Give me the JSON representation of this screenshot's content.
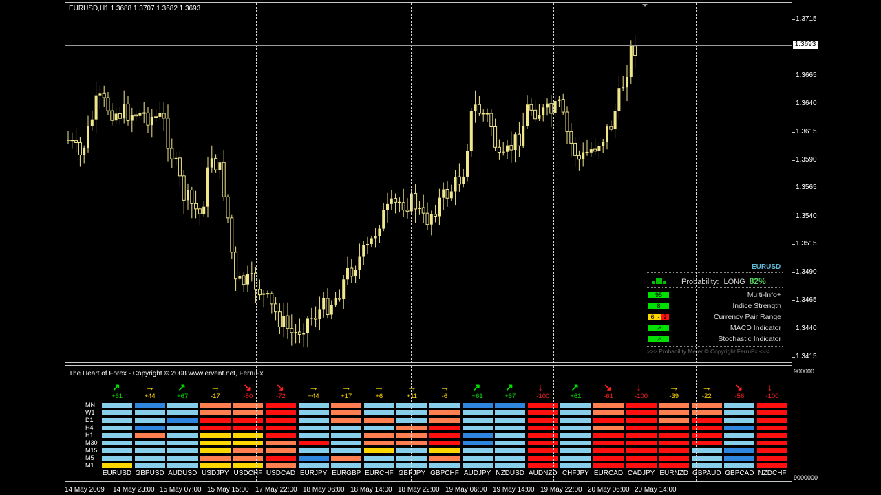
{
  "chart": {
    "header": "EURUSD,H1  1.3688 1.3707 1.3682 1.3693",
    "current_price": "1.3693",
    "price_ticks": [
      "1.3715",
      "1.3665",
      "1.3640",
      "1.3615",
      "1.3590",
      "1.3565",
      "1.3540",
      "1.3515",
      "1.3490",
      "1.3465",
      "1.3440",
      "1.3415"
    ],
    "time_ticks": [
      "14 May 2009",
      "14 May 23:00",
      "15 May 07:00",
      "15 May 15:00",
      "17 May 22:00",
      "18 May 06:00",
      "18 May 14:00",
      "18 May 22:00",
      "19 May 06:00",
      "19 May 14:00",
      "19 May 22:00",
      "20 May 06:00",
      "20 May 14:00"
    ],
    "candle_color": "#f0e68c"
  },
  "hud": {
    "symbol": "EURUSD",
    "probability_label": "Probability:",
    "direction": "LONG",
    "percent": "82%",
    "rows": [
      {
        "value": "95",
        "label": "Multi-Info+"
      },
      {
        "value": "8",
        "label": "Indice Strength"
      },
      {
        "value_a": "6",
        "sep": "-",
        "value_b": "2",
        "label": "Currency Pair Range"
      },
      {
        "value": "↗",
        "label": "MACD Indicator"
      },
      {
        "value": "↗",
        "label": "Stochastic Indicator"
      }
    ],
    "footer": ">>> Probability Meter © Copyright FerruFx <<<"
  },
  "indicator": {
    "title": "The Heart of Forex - Copyright © 2008 www.ervent.net, FerruFx",
    "scale_top": "900000",
    "scale_bottom": "9000000",
    "timeframes": [
      "MN",
      "W1",
      "D1",
      "H4",
      "H1",
      "M30",
      "M15",
      "M5",
      "M1"
    ],
    "pairs": [
      {
        "name": "EURUSD",
        "value": "+61",
        "arrow": "↗",
        "color": "#00e000"
      },
      {
        "name": "GBPUSD",
        "value": "+44",
        "arrow": "→",
        "color": "#ffd700"
      },
      {
        "name": "AUDUSD",
        "value": "+67",
        "arrow": "↗",
        "color": "#00e000"
      },
      {
        "name": "USDJPY",
        "value": "-17",
        "arrow": "→",
        "color": "#ffd700"
      },
      {
        "name": "USDCHF",
        "value": "-50",
        "arrow": "↘",
        "color": "#ff2020"
      },
      {
        "name": "USDCAD",
        "value": "-72",
        "arrow": "↘",
        "color": "#ff2020"
      },
      {
        "name": "EURJPY",
        "value": "+44",
        "arrow": "→",
        "color": "#ffd700"
      },
      {
        "name": "EURGBP",
        "value": "+17",
        "arrow": "→",
        "color": "#ffd700"
      },
      {
        "name": "EURCHF",
        "value": "+6",
        "arrow": "→",
        "color": "#ffd700"
      },
      {
        "name": "GBPJPY",
        "value": "+11",
        "arrow": "→",
        "color": "#ffd700"
      },
      {
        "name": "GBPCHF",
        "value": "-6",
        "arrow": "→",
        "color": "#ffd700"
      },
      {
        "name": "AUDJPY",
        "value": "+61",
        "arrow": "↗",
        "color": "#00e000"
      },
      {
        "name": "NZDUSD",
        "value": "+67",
        "arrow": "↗",
        "color": "#00e000"
      },
      {
        "name": "AUDNZD",
        "value": "-100",
        "arrow": "↓",
        "color": "#ff2020"
      },
      {
        "name": "CHFJPY",
        "value": "+61",
        "arrow": "↗",
        "color": "#00e000"
      },
      {
        "name": "EURCAD",
        "value": "-61",
        "arrow": "↘",
        "color": "#ff2020"
      },
      {
        "name": "CADJPY",
        "value": "-100",
        "arrow": "↓",
        "color": "#ff2020"
      },
      {
        "name": "EURNZD",
        "value": "-39",
        "arrow": "→",
        "color": "#ffd700"
      },
      {
        "name": "GBPAUD",
        "value": "-22",
        "arrow": "→",
        "color": "#ffd700"
      },
      {
        "name": "GBPCAD",
        "value": "-56",
        "arrow": "↘",
        "color": "#ff2020"
      },
      {
        "name": "NZDCHF",
        "value": "-100",
        "arrow": "↓",
        "color": "#ff2020"
      }
    ],
    "palette": {
      "L": "#87ceeb",
      "B": "#2e86de",
      "O": "#ff7f50",
      "R": "#ff1010",
      "Y": "#ffd700"
    },
    "grid": [
      "LBLOORLOLLLBBRLOROOLR",
      "LLLOORLOLLOLLRLOROOLR",
      "LLBRRRLOOLOLLRLRRORLR",
      "LBLRRRLLLORLLRLORRRBR",
      "LOLYYRLLOORBLRLRRRRLR",
      "LLLYYORLOORBLRLRRRRLR",
      "LLLYOOLLYLYLLRLRRRLBR",
      "LLLOORBOLLOLLRLRRRLBR",
      "YLLYYOLLLLLLLRLRRRLLR"
    ]
  }
}
